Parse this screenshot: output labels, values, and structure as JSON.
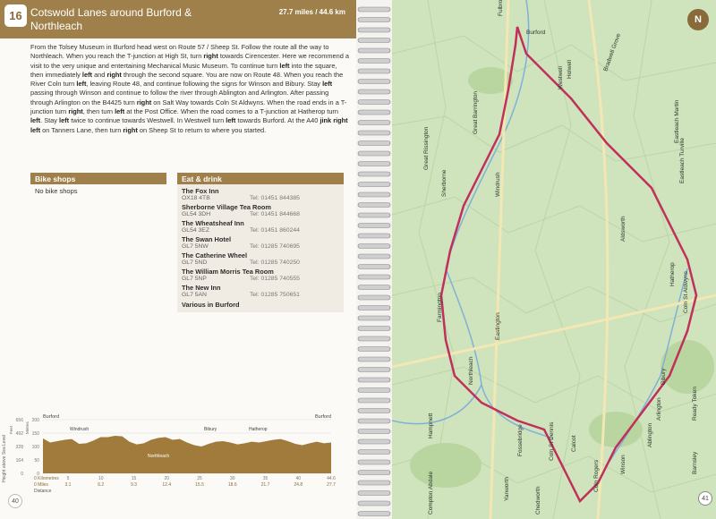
{
  "route": {
    "number": "16",
    "title": "Cotswold Lanes around Burford & Northleach",
    "distance": "27.7 miles / 44.6 km"
  },
  "description": [
    {
      "t": "From the Tolsey Museum in Burford head west on Route 57 / Sheep St. Follow the route all the way to Northleach. When you reach the T-junction at High St, turn "
    },
    {
      "b": "right"
    },
    {
      "t": " towards Cirencester. Here we recommend a visit to the very unique and entertaining Mechanical Music Museum. To continue turn "
    },
    {
      "b": "left"
    },
    {
      "t": " into the square, then immediately "
    },
    {
      "b": "left"
    },
    {
      "t": " and "
    },
    {
      "b": "right"
    },
    {
      "t": " through the second square. You are now on Route 48. When you reach the River Coln turn "
    },
    {
      "b": "left"
    },
    {
      "t": ", leaving Route 48, and continue following the signs for Winson and Bibury. Stay "
    },
    {
      "b": "left"
    },
    {
      "t": " passing through Winson and continue to follow the river through Ablington and Arlington. After passing through Arlington on the B4425 turn "
    },
    {
      "b": "right"
    },
    {
      "t": " on Salt Way towards Coln St Aldwyns. When the road ends in a T-junction turn "
    },
    {
      "b": "right"
    },
    {
      "t": ", then turn "
    },
    {
      "b": "left"
    },
    {
      "t": " at the Post Office. When the road comes to a T-junction at Hatherop turn "
    },
    {
      "b": "left"
    },
    {
      "t": ". Stay "
    },
    {
      "b": "left"
    },
    {
      "t": " twice to continue towards Westwell. In Westwell turn "
    },
    {
      "b": "left"
    },
    {
      "t": " towards Burford. At the A40 "
    },
    {
      "b": "jink right left"
    },
    {
      "t": " on Tanners Lane, then turn "
    },
    {
      "b": "right"
    },
    {
      "t": " on Sheep St to return to where you started."
    }
  ],
  "bike_shops": {
    "heading": "Bike shops",
    "body": "No bike shops"
  },
  "eat_drink": {
    "heading": "Eat & drink",
    "venues": [
      {
        "name": "The Fox Inn",
        "postcode": "OX18 4TB",
        "tel": "Tel: 01451 844385"
      },
      {
        "name": "Sherborne Village Tea Room",
        "postcode": "GL54 3DH",
        "tel": "Tel: 01451 844668"
      },
      {
        "name": "The Wheatsheaf Inn",
        "postcode": "GL54 3EZ",
        "tel": "Tel: 01451 860244"
      },
      {
        "name": "The Swan Hotel",
        "postcode": "GL7 5NW",
        "tel": "Tel: 01285 740695"
      },
      {
        "name": "The Catherine Wheel",
        "postcode": "GL7 5ND",
        "tel": "Tel: 01285 740250"
      },
      {
        "name": "The William Morris Tea Room",
        "postcode": "GL7 5NP",
        "tel": "Tel: 01285 740555"
      },
      {
        "name": "The New Inn",
        "postcode": "GL7 5AN",
        "tel": "Tel: 01285 750651"
      }
    ],
    "extra": "Various in Burford"
  },
  "profile": {
    "y_title": "Height above Sea Level",
    "y_feet": "Feet",
    "y_metres": "Metres",
    "y_ticks_m": [
      "200",
      "150",
      "100",
      "50",
      "0"
    ],
    "y_ticks_ft": [
      "656",
      "492",
      "328",
      "164",
      "0"
    ],
    "places_top": [
      "Burford",
      "Burford"
    ],
    "places_mid": [
      "Windrush",
      "Bibury",
      "Hatherop"
    ],
    "place_low": "Northleach",
    "km_label": "0 Kilometres",
    "km_ticks": [
      "5",
      "10",
      "15",
      "20",
      "25",
      "30",
      "35",
      "40",
      "44.6"
    ],
    "mi_label": "0 Miles",
    "mi_ticks": [
      "3.1",
      "6.2",
      "9.3",
      "12.4",
      "15.5",
      "18.6",
      "21.7",
      "24.8",
      "27.7"
    ],
    "distance_label": "Distance",
    "heights_m": [
      130,
      115,
      120,
      125,
      128,
      110,
      112,
      122,
      135,
      135,
      140,
      138,
      118,
      108,
      112,
      125,
      132,
      135,
      125,
      128,
      115,
      105,
      100,
      110,
      118,
      120,
      115,
      108,
      112,
      118,
      115,
      120,
      125,
      128,
      120,
      110,
      105,
      112,
      118,
      112,
      115
    ]
  },
  "page_left": "40",
  "page_right": "41",
  "compass": "N",
  "map_labels": [
    {
      "text": "Fulbrook"
    },
    {
      "text": "Burford"
    },
    {
      "text": "Westwell"
    },
    {
      "text": "Holwell"
    },
    {
      "text": "Bradwell Grove"
    },
    {
      "text": "Eastleach Martin"
    },
    {
      "text": "Eastleach Turville"
    },
    {
      "text": "Great Barrington"
    },
    {
      "text": "Great Rissington"
    },
    {
      "text": "Windrush"
    },
    {
      "text": "Sherborne"
    },
    {
      "text": "Aldsworth"
    },
    {
      "text": "Hatherop"
    },
    {
      "text": "Coln St Aldwyns"
    },
    {
      "text": "Farmington"
    },
    {
      "text": "Eastington"
    },
    {
      "text": "Northleach"
    },
    {
      "text": "Hampnett"
    },
    {
      "text": "Bibury"
    },
    {
      "text": "Arlington"
    },
    {
      "text": "Ablington"
    },
    {
      "text": "Winson"
    },
    {
      "text": "Fossebridge"
    },
    {
      "text": "Yanworth"
    },
    {
      "text": "Coln St Dennis"
    },
    {
      "text": "Calcot"
    },
    {
      "text": "Coln Rogers"
    },
    {
      "text": "Chedworth"
    },
    {
      "text": "Compton Abdale"
    },
    {
      "text": "Ready Token"
    },
    {
      "text": "Barnsley"
    }
  ],
  "colors": {
    "accent": "#a0804a",
    "route": "#c0305a",
    "map_bg": "#cfe3bd"
  }
}
